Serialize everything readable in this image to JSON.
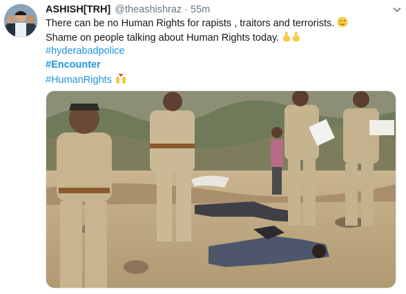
{
  "tweet": {
    "author": {
      "name": "ASHISH[TRH]",
      "handle": "@theashishraz",
      "time": "55m"
    },
    "text_lines": [
      "There can be no Human Rights for rapists , traitors and terrorists.",
      "Shame on people talking about Human Rights today."
    ],
    "hashtags": [
      "#hyderabadpolice",
      "#Encounter",
      "#HumanRights"
    ],
    "icons": {
      "avatar": "profile-photo",
      "menu": "chevron-down-icon",
      "emoji_1": "relieved-face-emoji",
      "emoji_2": "raised-finger-emoji",
      "emoji_3": "hearts-raised-hands-emoji"
    },
    "colors": {
      "link": "#1b95e0",
      "secondary_text": "#657786",
      "primary_text": "#14171a"
    }
  }
}
